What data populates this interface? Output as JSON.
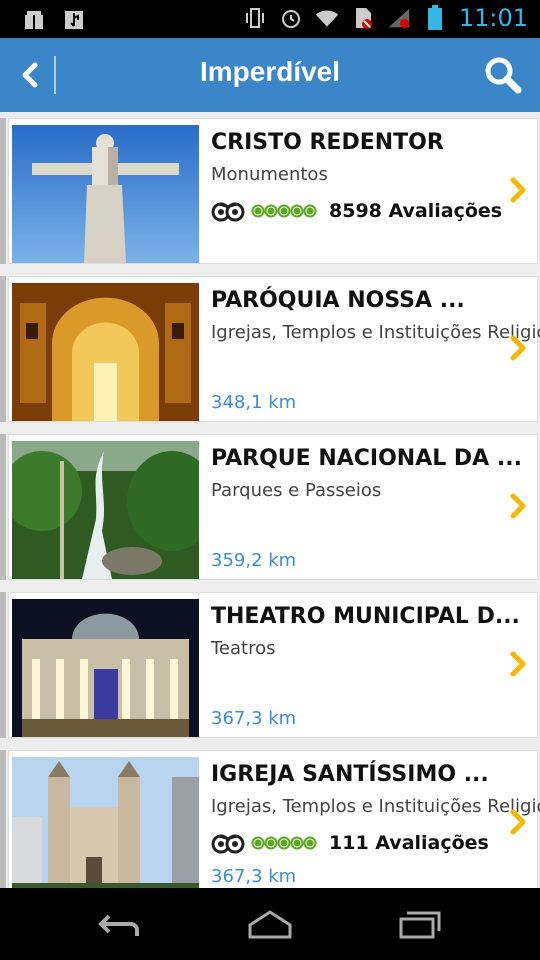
{
  "status_bar": {
    "time": "11:01",
    "left_icons": [
      "notification-box-icon",
      "usb-icon"
    ],
    "right_icons": [
      "vibrate-icon",
      "alarm-icon",
      "wifi-icon",
      "no-sim-icon",
      "signal-icon",
      "battery-icon"
    ],
    "time_color": "#33b5e5"
  },
  "app_bar": {
    "title": "Imperdível",
    "color": "#3a86c8"
  },
  "items": [
    {
      "name": "CRISTO REDENTOR",
      "category": "Monumentos",
      "reviews": "8598 Avaliações",
      "distance": "",
      "rating_bubbles": 5,
      "image": "christ-redeemer-photo"
    },
    {
      "name": "PARÓQUIA NOSSA ...",
      "category": "Igrejas, Templos e Instituições Religiosas",
      "reviews": "",
      "distance": "348,1 km",
      "rating_bubbles": 0,
      "image": "golden-church-interior-photo"
    },
    {
      "name": "PARQUE NACIONAL DA ...",
      "category": "Parques e Passeios",
      "reviews": "",
      "distance": "359,2 km",
      "rating_bubbles": 0,
      "image": "waterfall-forest-photo"
    },
    {
      "name": "THEATRO MUNICIPAL D...",
      "category": "Teatros",
      "reviews": "",
      "distance": "367,3 km",
      "rating_bubbles": 0,
      "image": "theatre-night-photo"
    },
    {
      "name": "IGREJA SANTÍSSIMO ...",
      "category": "Igrejas, Templos e Instituições Religiosas",
      "reviews": "111 Avaliações",
      "distance": "367,3 km",
      "rating_bubbles": 5,
      "image": "church-facade-photo"
    }
  ],
  "nav_bar": {
    "buttons": [
      "back-icon",
      "home-icon",
      "recent-apps-icon"
    ]
  },
  "colors": {
    "accent_blue": "#3f8dcf",
    "chevron_yellow": "#f5b800",
    "rating_green": "#5aa820"
  }
}
